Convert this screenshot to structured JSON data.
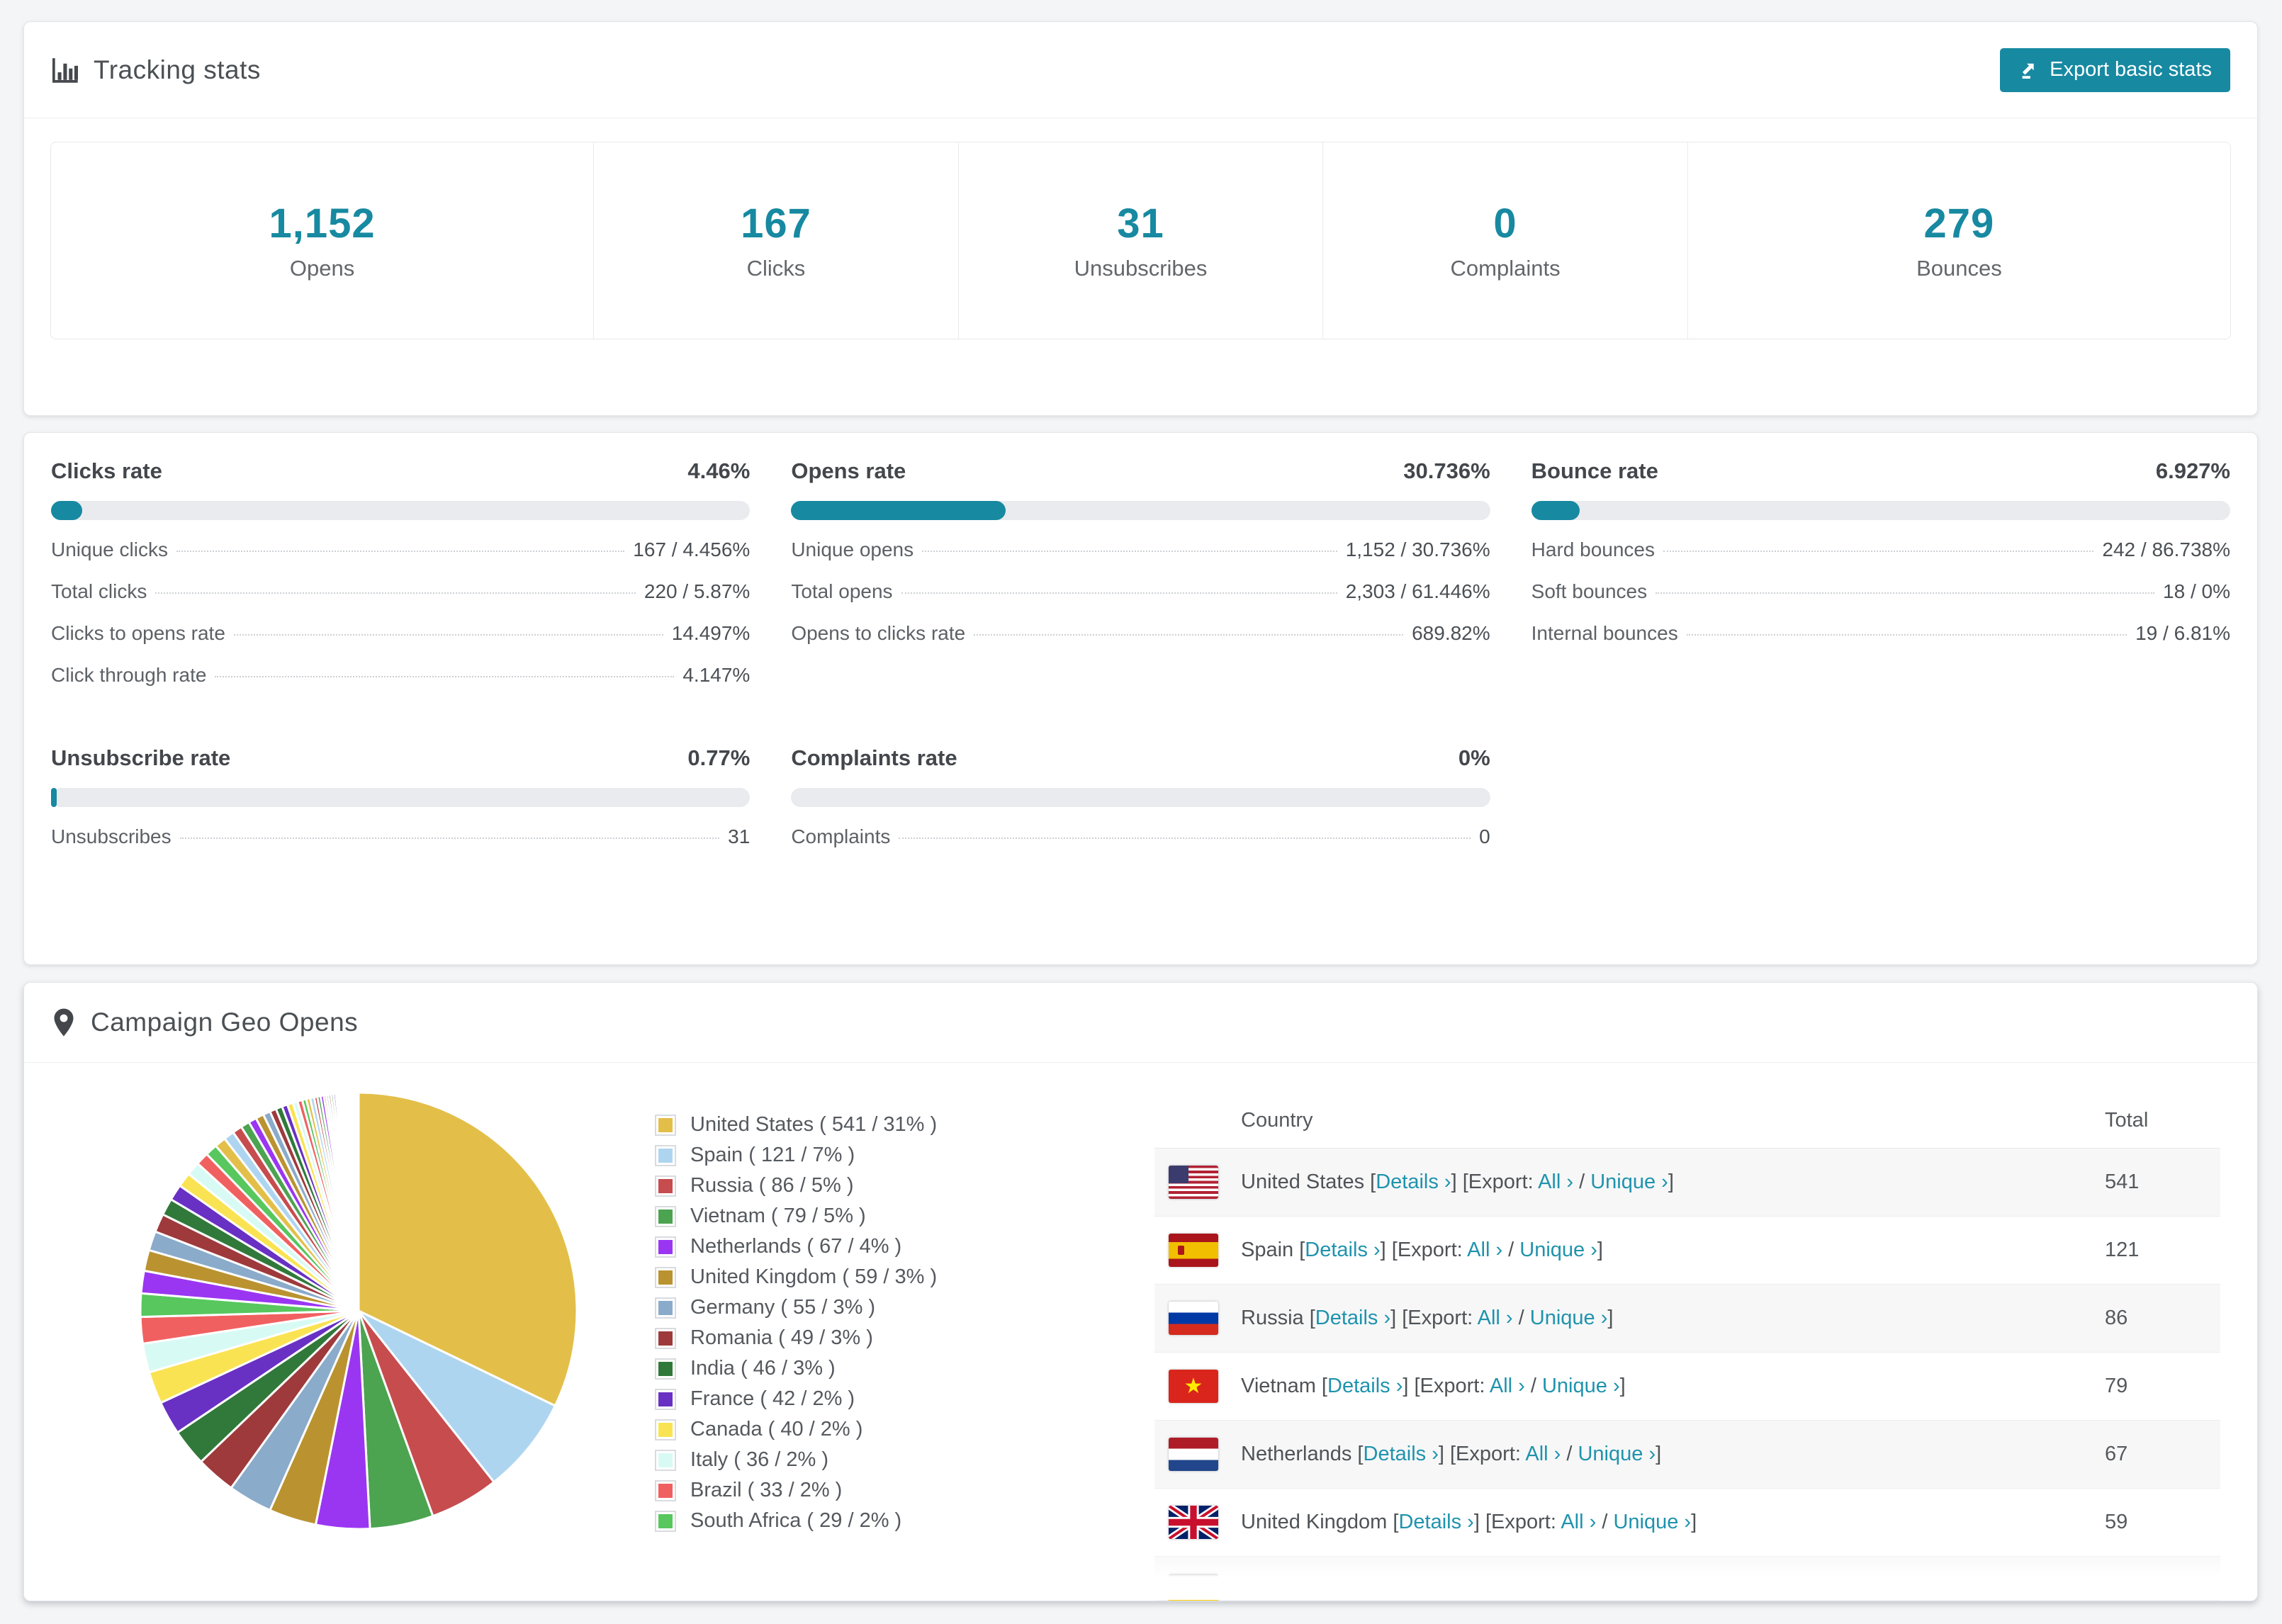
{
  "colors": {
    "accent": "#1789a1",
    "link": "#1f93ad",
    "bar_track": "#e9ebee",
    "page_bg": "#f4f5f6"
  },
  "tracking": {
    "title": "Tracking stats",
    "export_label": "Export basic stats",
    "stats": [
      {
        "value": "1,152",
        "label": "Opens"
      },
      {
        "value": "167",
        "label": "Clicks"
      },
      {
        "value": "31",
        "label": "Unsubscribes"
      },
      {
        "value": "0",
        "label": "Complaints"
      },
      {
        "value": "279",
        "label": "Bounces"
      }
    ]
  },
  "rates": [
    {
      "title": "Clicks rate",
      "value": "4.46%",
      "pct": 4.46,
      "rows": [
        {
          "label": "Unique clicks",
          "value": "167 / 4.456%"
        },
        {
          "label": "Total clicks",
          "value": "220 / 5.87%"
        },
        {
          "label": "Clicks to opens rate",
          "value": "14.497%"
        },
        {
          "label": "Click through rate",
          "value": "4.147%"
        }
      ]
    },
    {
      "title": "Opens rate",
      "value": "30.736%",
      "pct": 30.736,
      "rows": [
        {
          "label": "Unique opens",
          "value": "1,152 / 30.736%"
        },
        {
          "label": "Total opens",
          "value": "2,303 / 61.446%"
        },
        {
          "label": "Opens to clicks rate",
          "value": "689.82%"
        }
      ]
    },
    {
      "title": "Bounce rate",
      "value": "6.927%",
      "pct": 6.927,
      "rows": [
        {
          "label": "Hard bounces",
          "value": "242 / 86.738%"
        },
        {
          "label": "Soft bounces",
          "value": "18 / 0%"
        },
        {
          "label": "Internal bounces",
          "value": "19 / 6.81%"
        }
      ]
    },
    {
      "title": "Unsubscribe rate",
      "value": "0.77%",
      "pct": 0.77,
      "rows": [
        {
          "label": "Unsubscribes",
          "value": "31"
        }
      ]
    },
    {
      "title": "Complaints rate",
      "value": "0%",
      "pct": 0,
      "rows": [
        {
          "label": "Complaints",
          "value": "0"
        }
      ]
    }
  ],
  "geo": {
    "title": "Campaign Geo Opens",
    "table": {
      "headers": {
        "country": "Country",
        "total": "Total"
      },
      "details_label": "Details",
      "export_prefix": "Export:",
      "all_label": "All",
      "unique_label": "Unique",
      "chevron": "›",
      "rows": [
        {
          "country": "United States",
          "flag": "us",
          "total": "541"
        },
        {
          "country": "Spain",
          "flag": "es",
          "total": "121"
        },
        {
          "country": "Russia",
          "flag": "ru",
          "total": "86"
        },
        {
          "country": "Vietnam",
          "flag": "vn",
          "total": "79"
        },
        {
          "country": "Netherlands",
          "flag": "nl",
          "total": "67"
        },
        {
          "country": "United Kingdom",
          "flag": "gb",
          "total": "59"
        },
        {
          "country": "",
          "flag": "de",
          "total": "",
          "partial": true
        }
      ]
    }
  },
  "chart_data": {
    "type": "pie",
    "title": "Campaign Geo Opens",
    "legend_position": "right",
    "legend_format": "{label} ( {value} / {pct} )",
    "start_angle_deg": 0,
    "direction": "clockwise",
    "series": [
      {
        "label": "United States",
        "value": 541,
        "pct": "31%",
        "color": "#e3bf4a"
      },
      {
        "label": "Spain",
        "value": 121,
        "pct": "7%",
        "color": "#aed5f0"
      },
      {
        "label": "Russia",
        "value": 86,
        "pct": "5%",
        "color": "#c74c4e"
      },
      {
        "label": "Vietnam",
        "value": 79,
        "pct": "5%",
        "color": "#4ca350"
      },
      {
        "label": "Netherlands",
        "value": 67,
        "pct": "4%",
        "color": "#9a36f2"
      },
      {
        "label": "United Kingdom",
        "value": 59,
        "pct": "3%",
        "color": "#ba9330"
      },
      {
        "label": "Germany",
        "value": 55,
        "pct": "3%",
        "color": "#8aabca"
      },
      {
        "label": "Romania",
        "value": 49,
        "pct": "3%",
        "color": "#9e3a3c"
      },
      {
        "label": "India",
        "value": 46,
        "pct": "3%",
        "color": "#30793a"
      },
      {
        "label": "France",
        "value": 42,
        "pct": "2%",
        "color": "#6930c4"
      },
      {
        "label": "Canada",
        "value": 40,
        "pct": "2%",
        "color": "#fae353"
      },
      {
        "label": "Italy",
        "value": 36,
        "pct": "2%",
        "color": "#d8faf5"
      },
      {
        "label": "Brazil",
        "value": 33,
        "pct": "2%",
        "color": "#f16060"
      },
      {
        "label": "South Africa",
        "value": 29,
        "pct": "2%",
        "color": "#57c75e"
      }
    ],
    "others_unlabeled_values": [
      28,
      26,
      24,
      23,
      21,
      20,
      18,
      17,
      16,
      15,
      14,
      13,
      12,
      11,
      10,
      10,
      9,
      8,
      8,
      7,
      7,
      6,
      6,
      5,
      5,
      5,
      4,
      4,
      4,
      3,
      3,
      3,
      3,
      3,
      2,
      2,
      2,
      2,
      2,
      2,
      2,
      1,
      1,
      1,
      1,
      1,
      1,
      1,
      1,
      1,
      1,
      1,
      1,
      1,
      1
    ]
  }
}
